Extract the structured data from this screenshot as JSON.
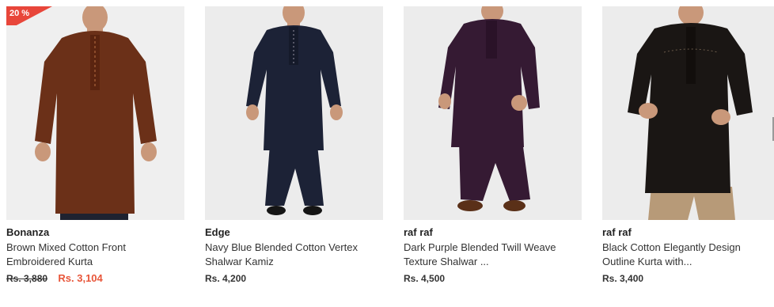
{
  "products": [
    {
      "badge": "20 %",
      "brand": "Bonanza",
      "title_line1": "Brown Mixed Cotton Front",
      "title_line2": "Embroidered Kurta",
      "old_price": "Rs. 3,880",
      "price": "Rs. 3,104",
      "garment_color": "#6b3018",
      "trouser_color": "#1e2230",
      "shoe_color": "#2a2a2a"
    },
    {
      "brand": "Edge",
      "title_line1": "Navy Blue Blended Cotton Vertex",
      "title_line2": "Shalwar Kamiz",
      "price": "Rs. 4,200",
      "garment_color": "#1c2236",
      "trouser_color": "#1c2236",
      "shoe_color": "#151515"
    },
    {
      "brand": "raf raf",
      "title_line1": "Dark Purple Blended Twill Weave",
      "title_line2": "Texture Shalwar ...",
      "price": "Rs. 4,500",
      "garment_color": "#351a33",
      "trouser_color": "#351a33",
      "shoe_color": "#5a3018"
    },
    {
      "brand": "raf raf",
      "title_line1": "Black Cotton Elegantly Design",
      "title_line2": "Outline Kurta with...",
      "price": "Rs. 3,400",
      "garment_color": "#1a1614",
      "trouser_color": "#b79a78",
      "shoe_color": "#b79a78"
    }
  ],
  "colors": {
    "sale_price": "#e8563a",
    "badge": "#e8463a",
    "skin": "#c9987a",
    "hair": "#2a1e18"
  }
}
